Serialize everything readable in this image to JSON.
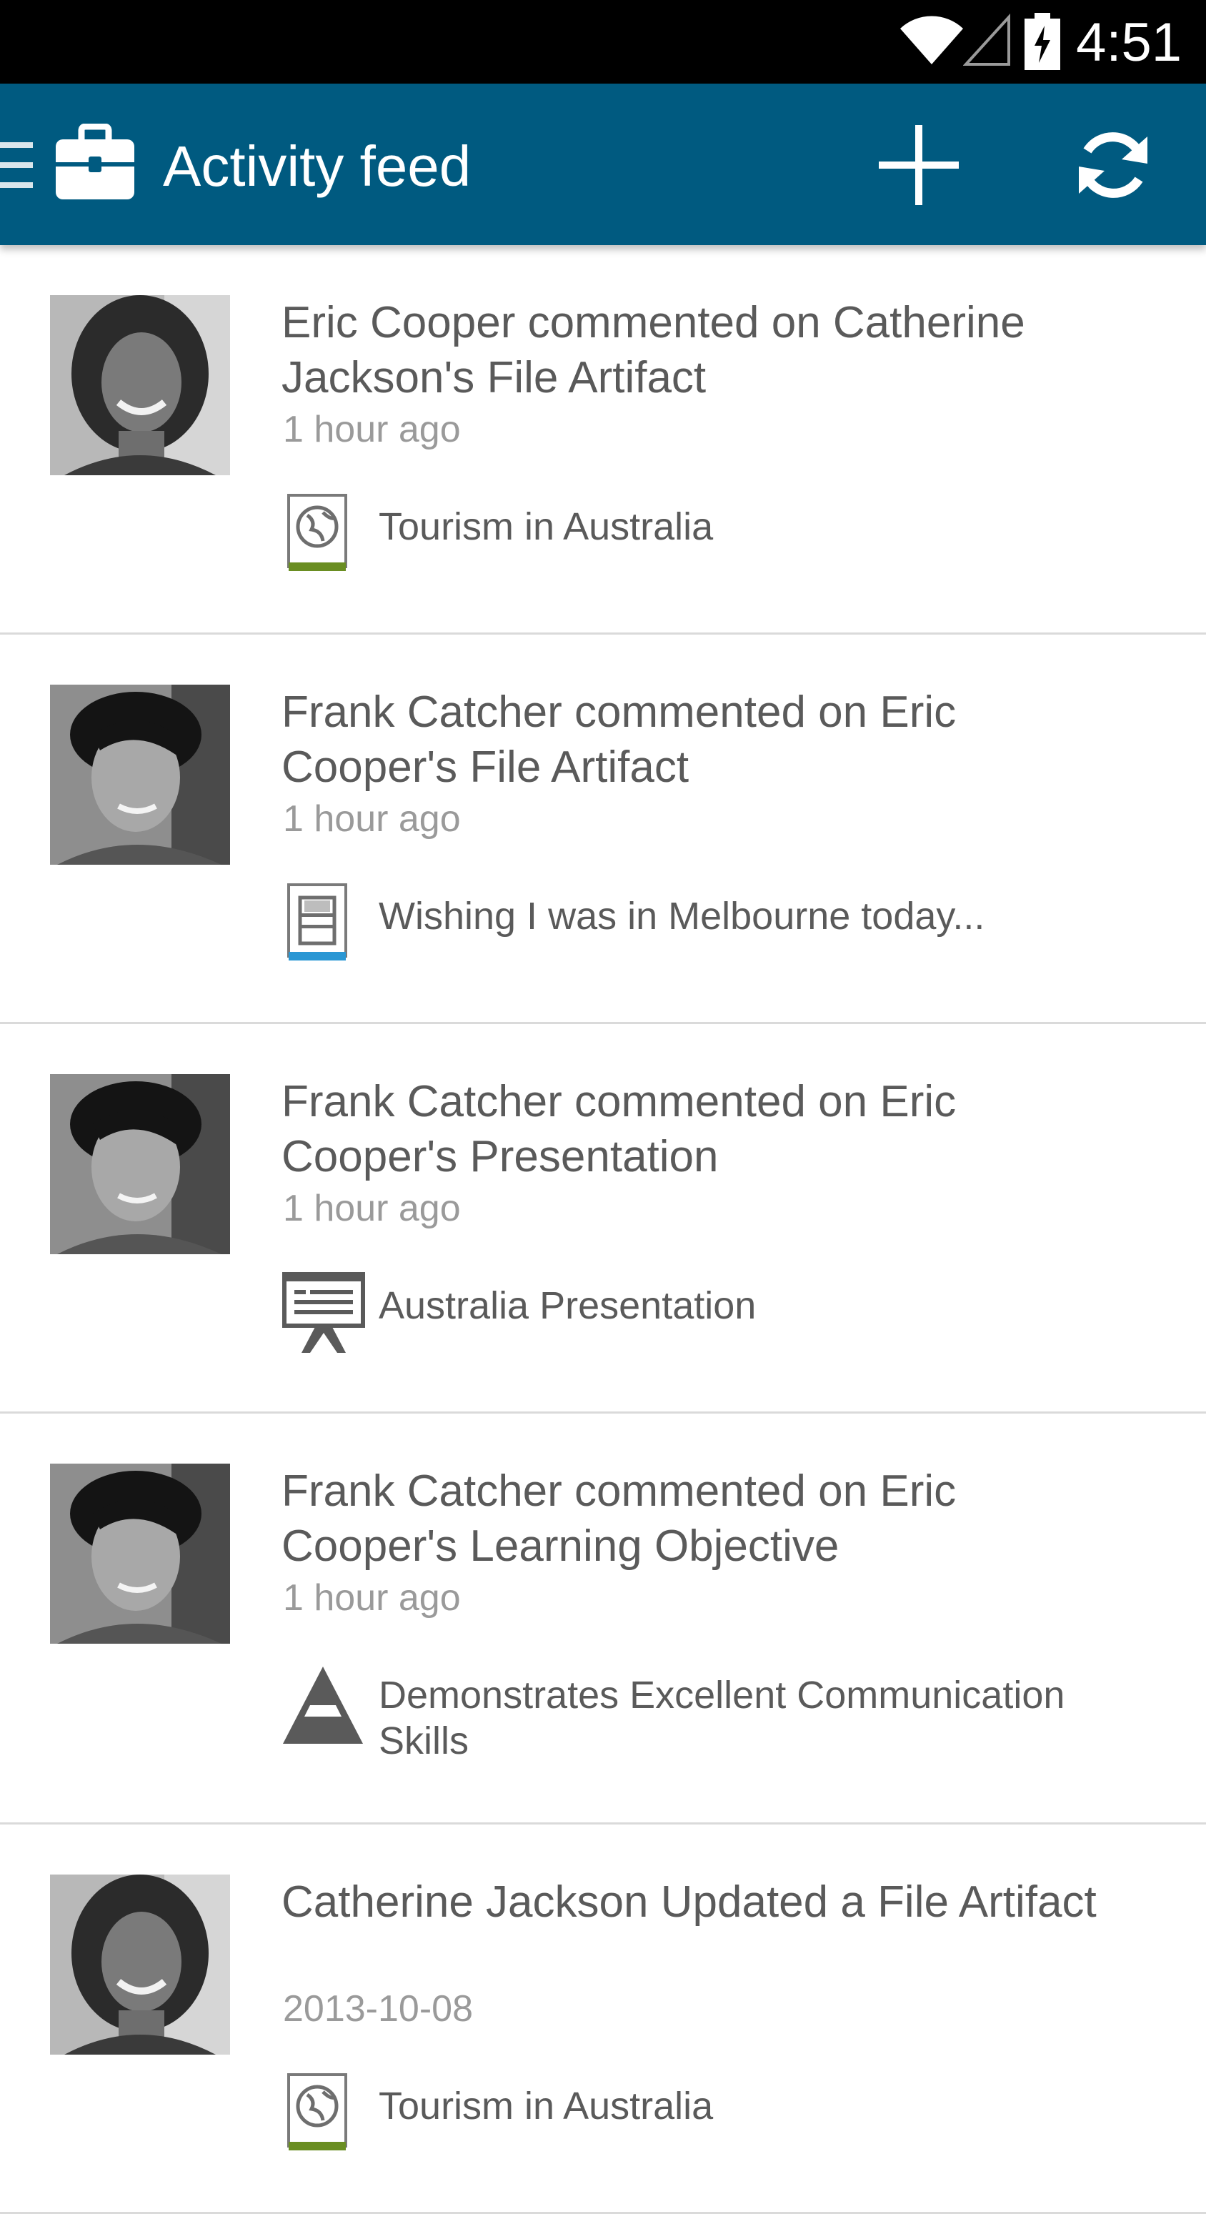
{
  "status_bar": {
    "time": "4:51",
    "icons": [
      "wifi-icon",
      "cell-signal-icon",
      "battery-charging-icon"
    ]
  },
  "app_bar": {
    "title": "Activity feed",
    "background": "#005a80",
    "icons": [
      "drawer-icon",
      "briefcase-icon",
      "add-icon",
      "refresh-icon"
    ]
  },
  "feed": {
    "items": [
      {
        "headline": "Eric Cooper commented on Catherine Jackson's File Artifact",
        "time": "1 hour ago",
        "artifact_label": "Tourism in Australia",
        "artifact_icon": "globe-file-icon",
        "avatar": "catherine-avatar"
      },
      {
        "headline": "Frank Catcher commented on Eric Cooper's File Artifact",
        "time": "1 hour ago",
        "artifact_label": "Wishing I was in Melbourne today...",
        "artifact_icon": "video-file-icon",
        "avatar": "frank-avatar"
      },
      {
        "headline": "Frank Catcher commented on Eric Cooper's Presentation",
        "time": "1 hour ago",
        "artifact_label": "Australia Presentation",
        "artifact_icon": "presentation-icon",
        "avatar": "frank-avatar"
      },
      {
        "headline": "Frank Catcher commented on Eric Cooper's Learning Objective",
        "time": "1 hour ago",
        "artifact_label": "Demonstrates Excellent Communication Skills",
        "artifact_icon": "learning-objective-icon",
        "avatar": "frank-avatar"
      },
      {
        "headline": "Catherine Jackson Updated a File Artifact",
        "time": "2013-10-08",
        "artifact_label": "Tourism in Australia",
        "artifact_icon": "globe-file-icon",
        "avatar": "catherine-avatar"
      }
    ]
  }
}
